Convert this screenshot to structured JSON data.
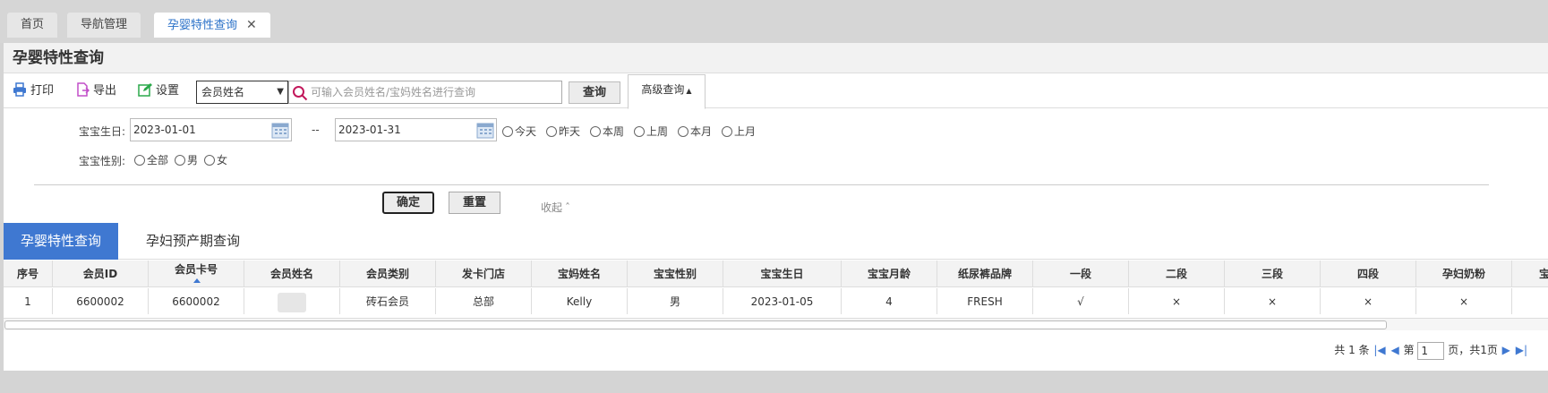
{
  "top_tabs": [
    {
      "label": "首页"
    },
    {
      "label": "导航管理"
    },
    {
      "label": "孕婴特性查询",
      "close": "✕"
    }
  ],
  "page_title": "孕婴特性查询",
  "toolbar": {
    "print_label": "打印",
    "export_label": "导出",
    "settings_label": "设置",
    "select_value": "会员姓名",
    "search_placeholder": "可输入会员姓名/宝妈姓名进行查询",
    "query_label": "查询",
    "advanced_label": "高级查询"
  },
  "filter": {
    "birth_label": "宝宝生日:",
    "date_from": "2023-01-01",
    "date_sep": "--",
    "date_to": "2023-01-31",
    "date_options": [
      "今天",
      "昨天",
      "本周",
      "上周",
      "本月",
      "上月"
    ],
    "gender_label": "宝宝性别:",
    "gender_options": [
      "全部",
      "男",
      "女"
    ],
    "ok_label": "确定",
    "reset_label": "重置",
    "collapse_label": "收起"
  },
  "result_tabs": [
    "孕婴特性查询",
    "孕妇预产期查询"
  ],
  "table": {
    "headers": [
      "序号",
      "会员ID",
      "会员卡号",
      "会员姓名",
      "会员类别",
      "发卡门店",
      "宝妈姓名",
      "宝宝性别",
      "宝宝生日",
      "宝宝月龄",
      "纸尿裤品牌",
      "一段",
      "二段",
      "三段",
      "四段",
      "孕妇奶粉",
      "宝"
    ],
    "rows": [
      [
        "1",
        "6600002",
        "6600002",
        "",
        "砖石会员",
        "总部",
        "Kelly",
        "男",
        "2023-01-05",
        "4",
        "FRESH",
        "√",
        "×",
        "×",
        "×",
        "×",
        ""
      ]
    ]
  },
  "pager": {
    "total_text": "共 1 条",
    "page_prefix": "第",
    "page_value": "1",
    "page_suffix": "页，共1页"
  },
  "colors": {
    "accent": "#3f78d1",
    "tab_active_text": "#2a71c8"
  }
}
